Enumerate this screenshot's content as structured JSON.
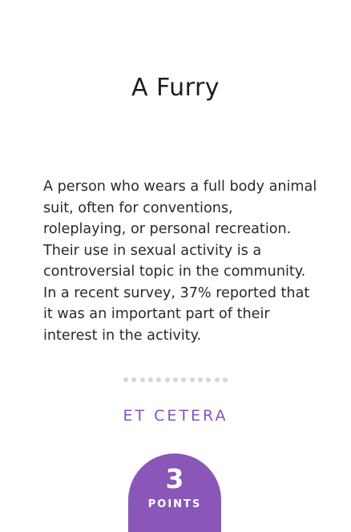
{
  "card": {
    "title": "A Furry",
    "description": "A person who wears a full body animal suit, often for conventions, roleplaying, or personal recreation. Their use in sexual activity is a controversial topic in the community. In a recent survey, 37% reported that it was an important part of their interest in the activity.",
    "category": "ET CETERA",
    "points": {
      "value": "3",
      "label": "POINTS"
    }
  },
  "colors": {
    "accent": "#8a57b8",
    "dots": "#d7d7d7",
    "text": "#1f1f1f"
  },
  "divider": {
    "dot_count": 13
  }
}
